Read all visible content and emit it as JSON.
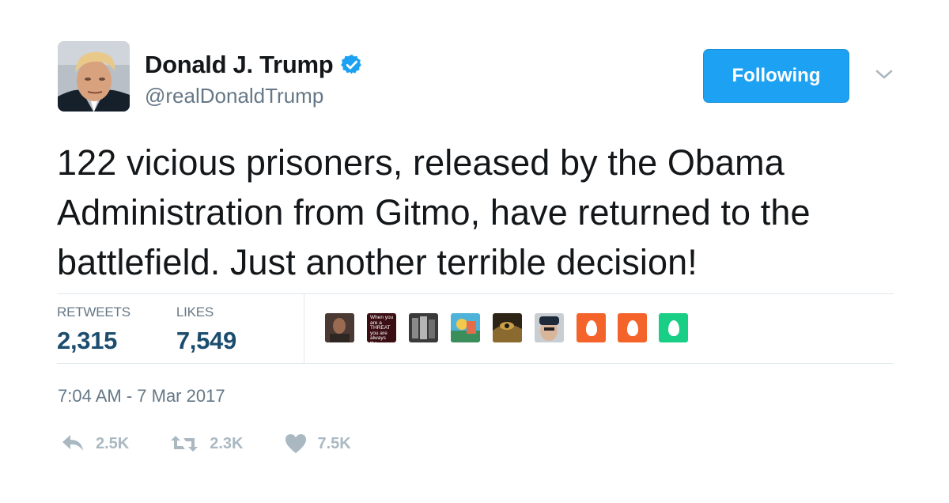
{
  "author": {
    "display_name": "Donald J. Trump",
    "handle": "@realDonaldTrump",
    "verified": true
  },
  "follow_button": {
    "label": "Following"
  },
  "tweet": {
    "text": "122 vicious prisoners, released by the Obama Administration from Gitmo, have returned to the battlefield. Just another terrible decision!"
  },
  "stats": {
    "retweets_label": "RETWEETS",
    "retweets_value": "2,315",
    "likes_label": "LIKES",
    "likes_value": "7,549"
  },
  "likers": {
    "threat_avatar_text": "When you are a THREAT you are always the TARGET"
  },
  "timestamp": "7:04 AM - 7 Mar 2017",
  "actions": {
    "reply_count": "2.5K",
    "retweet_count": "2.3K",
    "like_count": "7.5K"
  },
  "colors": {
    "accent": "#1da1f2",
    "stat_value": "#1c4d6e",
    "muted": "#657786",
    "action_gray": "#aab8c2",
    "egg_orange": "#f4642a",
    "egg_green": "#19cf86"
  },
  "icons": {
    "verified": "verified-badge-icon",
    "caret": "chevron-down-icon",
    "reply": "reply-icon",
    "retweet": "retweet-icon",
    "like": "heart-icon"
  }
}
